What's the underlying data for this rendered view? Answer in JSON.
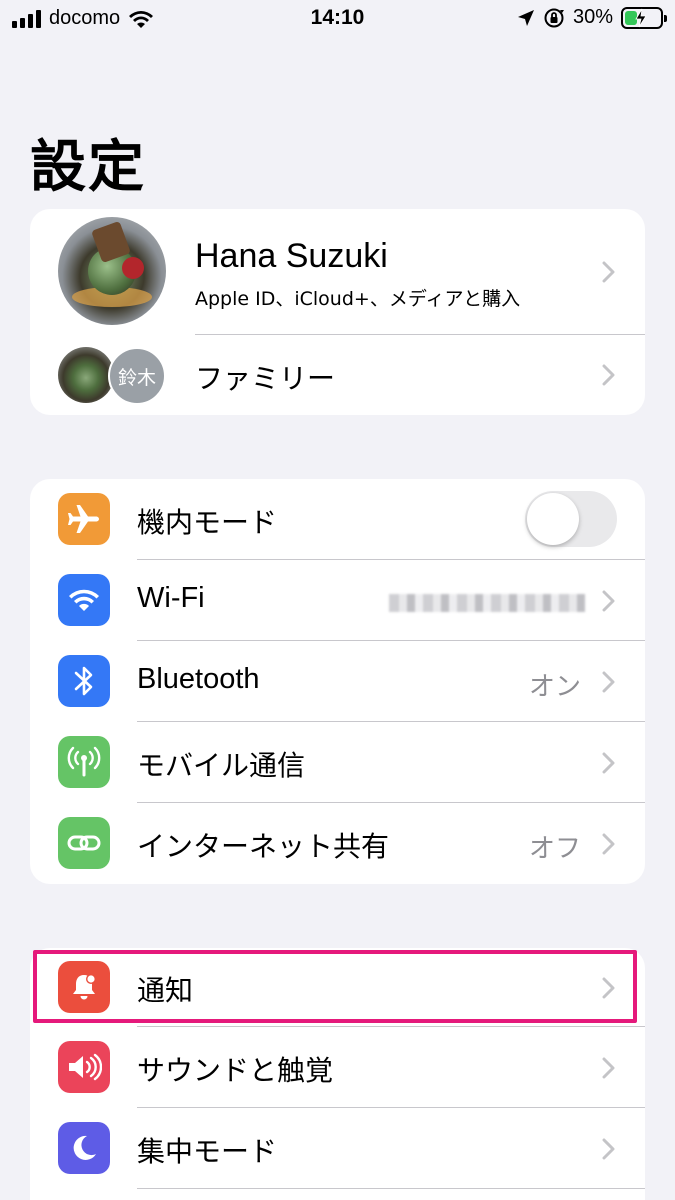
{
  "status_bar": {
    "carrier": "docomo",
    "time": "14:10",
    "battery_percent": "30%"
  },
  "page": {
    "title": "設定"
  },
  "profile": {
    "name": "Hana Suzuki",
    "subtitle": "Apple ID、iCloud+、メディアと購入",
    "family_label": "ファミリー",
    "family_member_initials": "鈴木"
  },
  "connectivity": {
    "airplane": {
      "label": "機内モード",
      "icon": "airplane-icon",
      "color": "#f19a37",
      "enabled": false
    },
    "wifi": {
      "label": "Wi-Fi",
      "icon": "wifi-icon",
      "color": "#3478f6"
    },
    "bluetooth": {
      "label": "Bluetooth",
      "value": "オン",
      "icon": "bluetooth-icon",
      "color": "#3478f6"
    },
    "cellular": {
      "label": "モバイル通信",
      "icon": "antenna-icon",
      "color": "#65c466"
    },
    "hotspot": {
      "label": "インターネット共有",
      "value": "オフ",
      "icon": "hotspot-link-icon",
      "color": "#65c466"
    }
  },
  "general": {
    "notifications": {
      "label": "通知",
      "icon": "bell-icon",
      "color": "#eb4e3d"
    },
    "sounds": {
      "label": "サウンドと触覚",
      "icon": "speaker-icon",
      "color": "#eb445a"
    },
    "focus": {
      "label": "集中モード",
      "icon": "moon-icon",
      "color": "#5e5ce6"
    }
  },
  "highlight_color": "#e5197b"
}
